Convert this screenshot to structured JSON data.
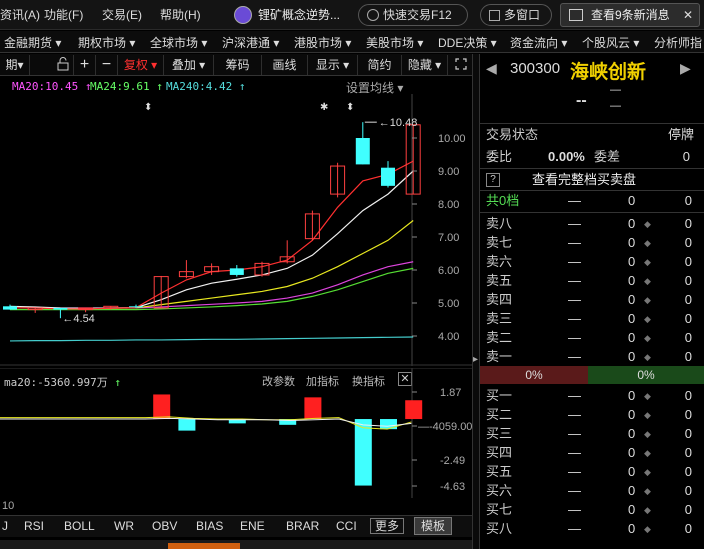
{
  "topbar": {
    "menus": [
      "资讯(A)",
      "功能(F)",
      "交易(E)",
      "帮助(H)"
    ],
    "notice_title": "锂矿概念逆势...",
    "quick_trade": "快速交易F12",
    "multi_window": "多窗口",
    "news": "查看9条新消息",
    "close_glyph": "✕"
  },
  "nav": {
    "items": [
      "金融期货",
      "期权市场",
      "全球市场",
      "沪深港通",
      "港股市场",
      "美股市场",
      "DDE决策",
      "资金流向",
      "个股风云",
      "分析师指"
    ]
  },
  "toolbar": {
    "period": "期",
    "restore": "复权",
    "overlay": "叠加",
    "chips": "筹码",
    "draw": "画线",
    "display": "显示",
    "simple": "简约",
    "hide": "隐藏"
  },
  "legend": {
    "ma20": "MA20:10.45",
    "ma24": "MA24:9.61",
    "ma240": "MA240:4.42",
    "settings": "设置均线"
  },
  "chart_data": {
    "type": "candlestick",
    "y_ticks": [
      10.0,
      9.0,
      8.0,
      7.0,
      6.0,
      5.0,
      4.0
    ],
    "high_label": "10.48",
    "low_label": "4.54",
    "candles": [
      {
        "o": 4.9,
        "h": 4.95,
        "l": 4.8,
        "c": 4.8
      },
      {
        "o": 4.8,
        "h": 4.85,
        "l": 4.7,
        "c": 4.85
      },
      {
        "o": 4.85,
        "h": 4.85,
        "l": 4.54,
        "c": 4.8
      },
      {
        "o": 4.8,
        "h": 4.86,
        "l": 4.72,
        "c": 4.85
      },
      {
        "o": 4.85,
        "h": 4.9,
        "l": 4.8,
        "c": 4.9
      },
      {
        "o": 4.9,
        "h": 4.95,
        "l": 4.85,
        "c": 4.88
      },
      {
        "o": 4.85,
        "h": 5.82,
        "l": 4.85,
        "c": 5.8
      },
      {
        "o": 5.8,
        "h": 6.3,
        "l": 5.75,
        "c": 5.95
      },
      {
        "o": 5.95,
        "h": 6.2,
        "l": 5.85,
        "c": 6.1
      },
      {
        "o": 6.05,
        "h": 6.15,
        "l": 5.8,
        "c": 5.85
      },
      {
        "o": 5.85,
        "h": 6.25,
        "l": 5.8,
        "c": 6.2
      },
      {
        "o": 6.25,
        "h": 6.9,
        "l": 6.2,
        "c": 6.4
      },
      {
        "o": 6.95,
        "h": 7.8,
        "l": 6.9,
        "c": 7.7
      },
      {
        "o": 8.3,
        "h": 9.25,
        "l": 8.2,
        "c": 9.15
      },
      {
        "o": 10.0,
        "h": 10.48,
        "l": 9.2,
        "c": 9.2
      },
      {
        "o": 9.1,
        "h": 9.3,
        "l": 8.5,
        "c": 8.55
      },
      {
        "o": 8.3,
        "h": 10.4,
        "l": 8.3,
        "c": 10.4
      }
    ],
    "ma_white": [
      4.9,
      4.88,
      4.85,
      4.84,
      4.85,
      4.86,
      5.1,
      5.4,
      5.6,
      5.72,
      5.85,
      6.05,
      6.45,
      7.1,
      7.8,
      8.3,
      9.0
    ],
    "ma_yellow": [
      4.85,
      4.85,
      4.84,
      4.84,
      4.84,
      4.85,
      4.95,
      5.05,
      5.15,
      5.25,
      5.35,
      5.5,
      5.75,
      6.1,
      6.5,
      6.9,
      7.5
    ],
    "ma_magenta": [
      4.85,
      4.85,
      4.85,
      4.85,
      4.85,
      4.85,
      4.88,
      4.92,
      4.96,
      5.0,
      5.05,
      5.15,
      5.3,
      5.55,
      5.85,
      6.1,
      6.25
    ],
    "ma_green": [
      4.8,
      4.8,
      4.8,
      4.8,
      4.8,
      4.8,
      4.82,
      4.85,
      4.88,
      4.92,
      4.97,
      5.05,
      5.2,
      5.4,
      5.65,
      5.9,
      6.05
    ],
    "ma_red": [
      4.85,
      4.85,
      4.82,
      4.82,
      4.84,
      4.86,
      5.3,
      5.7,
      5.95,
      6.0,
      6.1,
      6.3,
      6.9,
      7.9,
      8.7,
      8.9,
      9.3
    ],
    "ma240": [
      3.85,
      3.86,
      3.86,
      3.87,
      3.87,
      3.88,
      3.88,
      3.89,
      3.9,
      3.9,
      3.91,
      3.92,
      3.93,
      3.94,
      3.95,
      3.96,
      3.97
    ],
    "indicator": {
      "label": "ma20:-5360.997万",
      "y_ticks": [
        "1.87",
        "-4059.00",
        "-2.49",
        "-4.63"
      ],
      "bars": [
        0,
        0,
        0,
        0,
        0,
        0,
        0,
        1.7,
        -0.8,
        0,
        -0.3,
        0,
        -0.4,
        1.5,
        0,
        -4.6,
        -0.7,
        1.3
      ]
    }
  },
  "indicator_bar": {
    "param": "改参数",
    "add": "加指标",
    "switch": "换指标"
  },
  "bottom": {
    "tabs": [
      "J",
      "RSI",
      "BOLL",
      "WR",
      "OBV",
      "BIAS",
      "ENE",
      "BRAR",
      "CCI"
    ],
    "more": "更多",
    "template": "模板",
    "axis_label": "10"
  },
  "quote": {
    "code": "300300",
    "name": "海峡创新",
    "price": "--",
    "change_placeholder": "—",
    "trade_state_label": "交易状态",
    "trade_state": "停牌",
    "weibi_label": "委比",
    "weibi_value": "0.00%",
    "weicha_label": "委差",
    "weicha_value": "0",
    "view_full": "查看完整档买卖盘",
    "total_label": "共0档",
    "asks": [
      "卖八",
      "卖七",
      "卖六",
      "卖五",
      "卖四",
      "卖三",
      "卖二",
      "卖一"
    ],
    "bids": [
      "买一",
      "买二",
      "买三",
      "买四",
      "买五",
      "买六",
      "买七",
      "买八"
    ],
    "sell_pct": "0%",
    "buy_pct": "0%",
    "dash": "—",
    "zero": "0"
  }
}
